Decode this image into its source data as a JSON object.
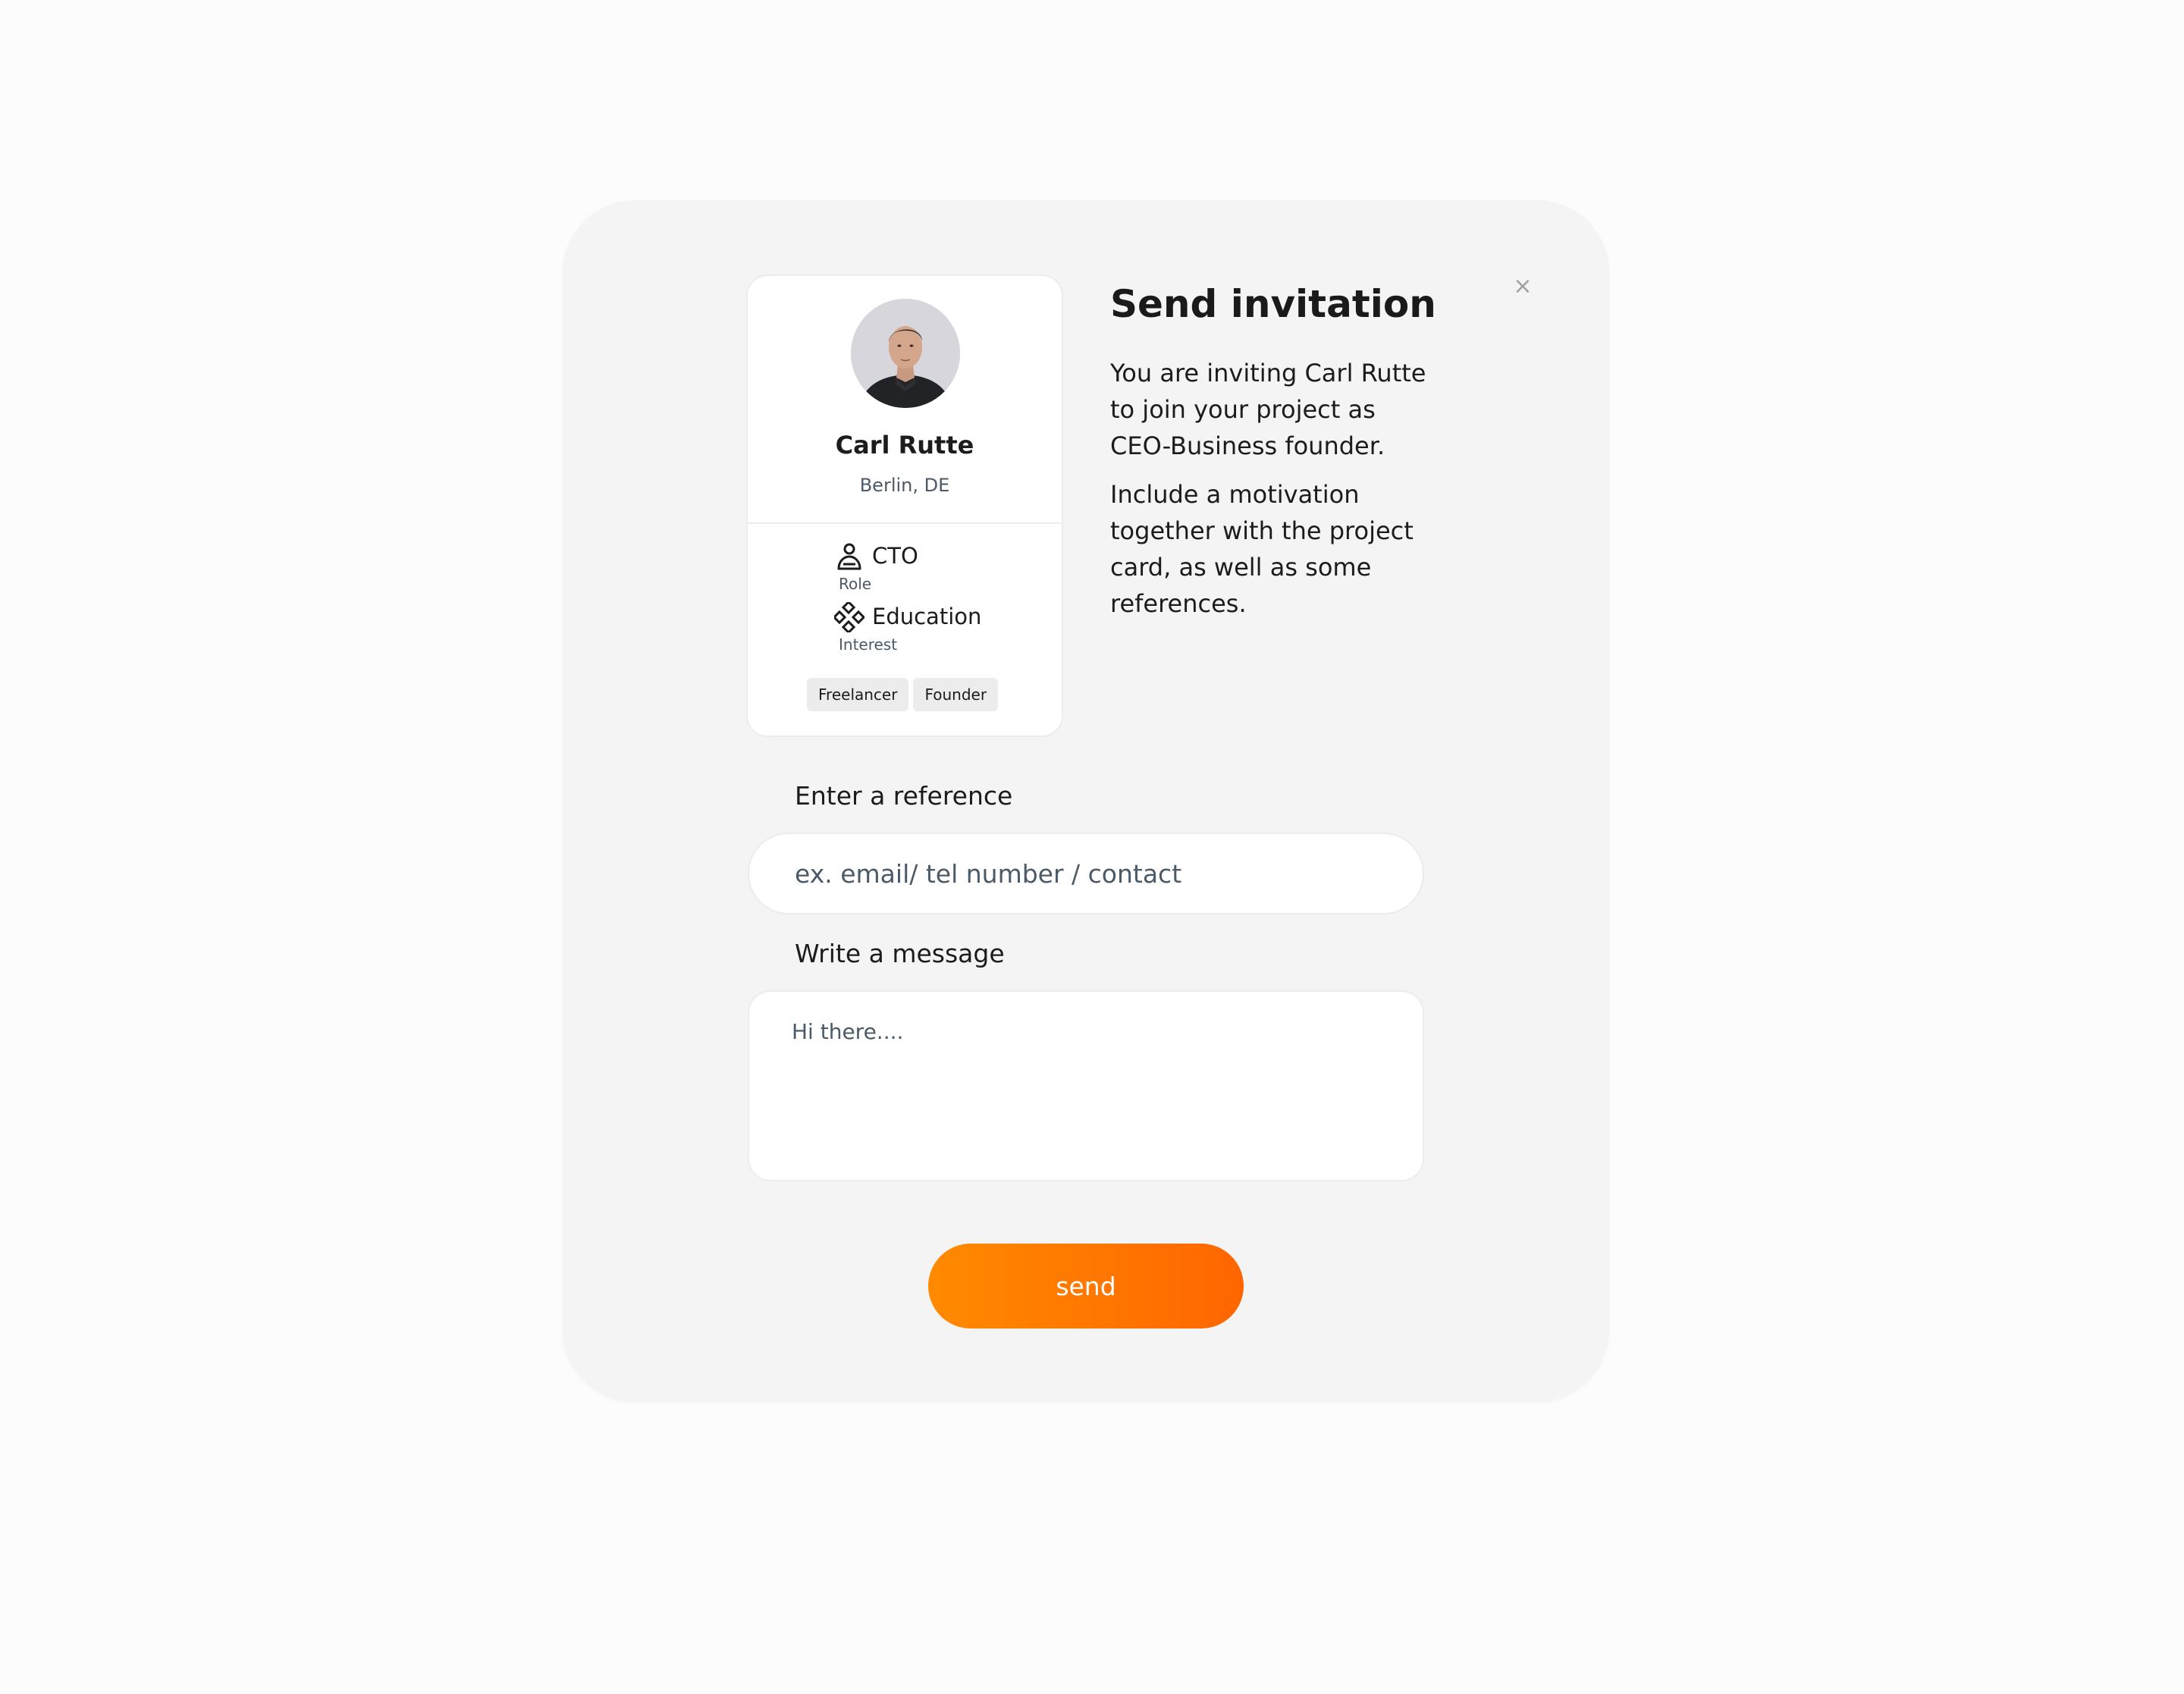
{
  "modal": {
    "title": "Send invitation",
    "description_1": "You are inviting Carl Rutte to join your project as CEO-Business founder.",
    "description_2": "Include a motivation together with the project card, as well as some references.",
    "close_icon": "close-icon",
    "close_symbol": "×"
  },
  "profile": {
    "name": "Carl Rutte",
    "location": "Berlin, DE",
    "avatar_icon": "avatar-photo",
    "role_value": "CTO",
    "role_caption": "Role",
    "role_icon": "person-icon",
    "interest_value": "Education",
    "interest_caption": "Interest",
    "interest_icon": "diamond-nodes-icon",
    "tags": [
      "Freelancer",
      "Founder"
    ]
  },
  "form": {
    "reference_label": "Enter a reference",
    "reference_placeholder": "ex. email/ tel number / contact",
    "reference_value": "",
    "message_label": "Write a message",
    "message_placeholder": "Hi there....",
    "message_value": "",
    "send_label": "send"
  },
  "colors": {
    "accent_start": "#ff8a00",
    "accent_end": "#ff6600",
    "modal_bg": "#f4f4f4",
    "muted_text": "#4a5a68"
  }
}
